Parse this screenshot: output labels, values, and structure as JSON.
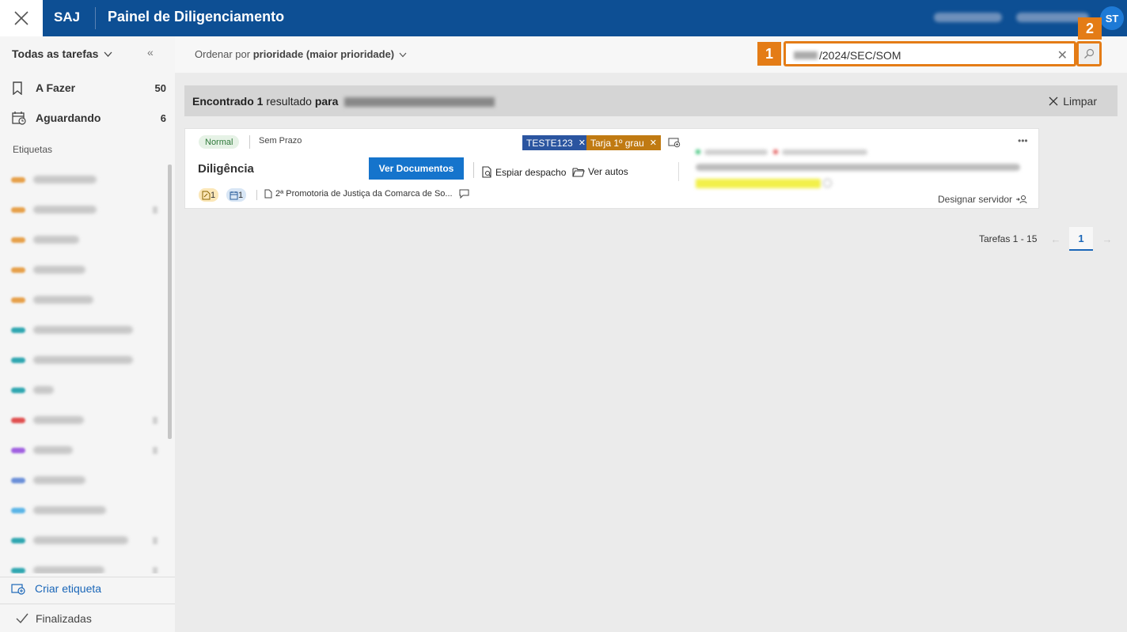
{
  "topbar": {
    "brand": "SAJ",
    "title": "Painel de Diligenciamento",
    "avatar_initials": "ST",
    "close_icon": "close-icon"
  },
  "sidebar": {
    "header": "Todas as tarefas",
    "items": [
      {
        "label": "A Fazer",
        "count": "50",
        "icon": "bookmark-icon"
      },
      {
        "label": "Aguardando",
        "count": "6",
        "icon": "calendar-clock-icon"
      }
    ],
    "labels_heading": "Etiquetas",
    "tag_colors": [
      "#e6a04a",
      "#e6a04a",
      "#e6a04a",
      "#e6a04a",
      "#e6a04a",
      "#2fa6b0",
      "#2fa6b0",
      "#2fa6b0",
      "#e05050",
      "#a060e0",
      "#6b8fd8",
      "#5ab4e6",
      "#2fa6b0",
      "#2fa6b0"
    ],
    "create_label": "Criar etiqueta",
    "finished_label": "Finalizadas"
  },
  "toolbar": {
    "order_prefix": "Ordenar por",
    "order_value": "prioridade (maior prioridade)",
    "search_value": "/2024/SEC/SOM",
    "badge_1": "1",
    "badge_2": "2"
  },
  "result": {
    "prefix": "Encontrado",
    "count": "1",
    "mid": "resultado",
    "suffix": "para",
    "clear_label": "Limpar"
  },
  "card": {
    "priority": "Normal",
    "deadline": "Sem Prazo",
    "tags": [
      {
        "label": "TESTE123",
        "color": "#2b55a0"
      },
      {
        "label": "Tarja 1º grau",
        "color": "#c07a12"
      }
    ],
    "title": "Diligência",
    "primary_action": "Ver Documentos",
    "action_spy": "Espiar despacho",
    "action_autos": "Ver autos",
    "count_a": "1",
    "count_b": "1",
    "origin": "2ª Promotoria de Justiça da Comarca de So...",
    "assign_label": "Designar servidor"
  },
  "pager": {
    "range_label": "Tarefas 1 - 15",
    "current_page": "1"
  }
}
